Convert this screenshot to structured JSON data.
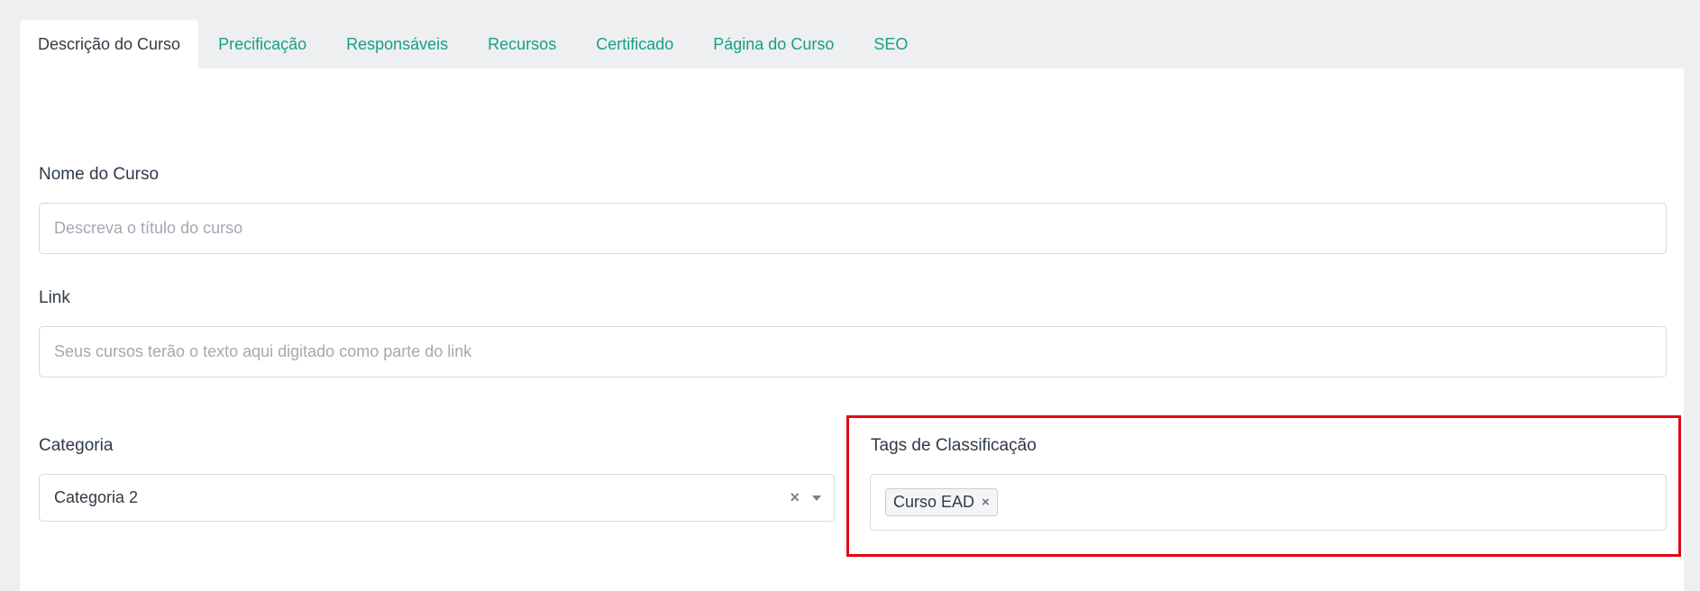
{
  "tabs": [
    {
      "label": "Descrição do Curso",
      "active": true
    },
    {
      "label": "Precificação"
    },
    {
      "label": "Responsáveis"
    },
    {
      "label": "Recursos"
    },
    {
      "label": "Certificado"
    },
    {
      "label": "Página do Curso"
    },
    {
      "label": "SEO"
    }
  ],
  "form": {
    "course_name": {
      "label": "Nome do Curso",
      "placeholder": "Descreva o título do curso"
    },
    "link": {
      "label": "Link",
      "placeholder": "Seus cursos terão o texto aqui digitado como parte do link"
    },
    "category": {
      "label": "Categoria",
      "value": "Categoria 2",
      "clear_icon": "×"
    },
    "tags": {
      "label": "Tags de Classificação",
      "items": [
        {
          "label": "Curso EAD",
          "remove_icon": "×"
        }
      ]
    }
  },
  "colors": {
    "accent": "#16a085",
    "highlight": "#e30613"
  }
}
